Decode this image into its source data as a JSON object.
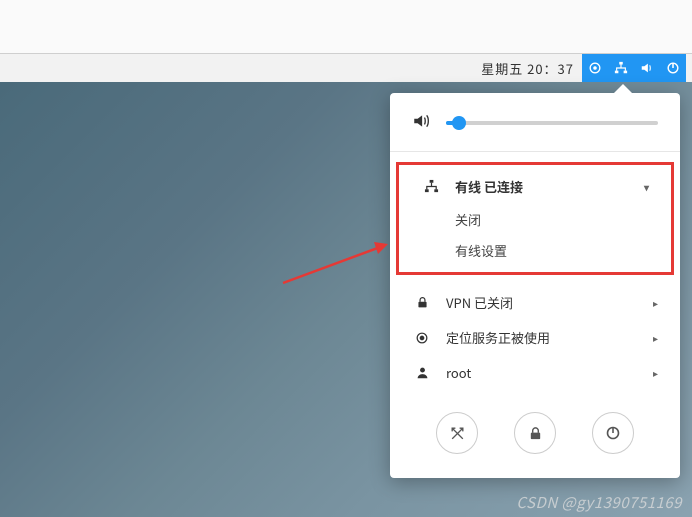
{
  "topbar": {
    "clock": "星期五 20：37"
  },
  "panel": {
    "volume_percent": 6,
    "wired": {
      "title": "有线 已连接",
      "off": "关闭",
      "settings": "有线设置"
    },
    "vpn": "VPN 已关闭",
    "location": "定位服务正被使用",
    "user": "root"
  },
  "watermark": "CSDN @gy1390751169"
}
